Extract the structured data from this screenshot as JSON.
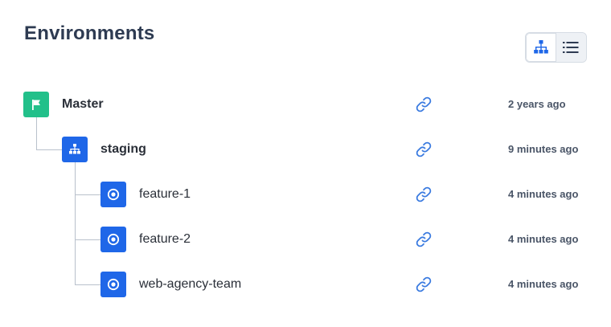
{
  "header": {
    "title": "Environments"
  },
  "view_toggle": {
    "options": [
      {
        "icon": "tree-view-icon",
        "active": true
      },
      {
        "icon": "list-view-icon",
        "active": false
      }
    ]
  },
  "colors": {
    "master": "#22c08a",
    "branch": "#1f67e8",
    "link": "#3b7be0"
  },
  "environments": [
    {
      "name": "Master",
      "icon": "flag-icon",
      "updated": "2 years ago"
    },
    {
      "name": "staging",
      "icon": "hierarchy-icon",
      "updated": "9 minutes ago"
    },
    {
      "name": "feature-1",
      "icon": "target-icon",
      "updated": "4 minutes ago"
    },
    {
      "name": "feature-2",
      "icon": "target-icon",
      "updated": "4 minutes ago"
    },
    {
      "name": "web-agency-team",
      "icon": "target-icon",
      "updated": "4 minutes ago"
    }
  ]
}
